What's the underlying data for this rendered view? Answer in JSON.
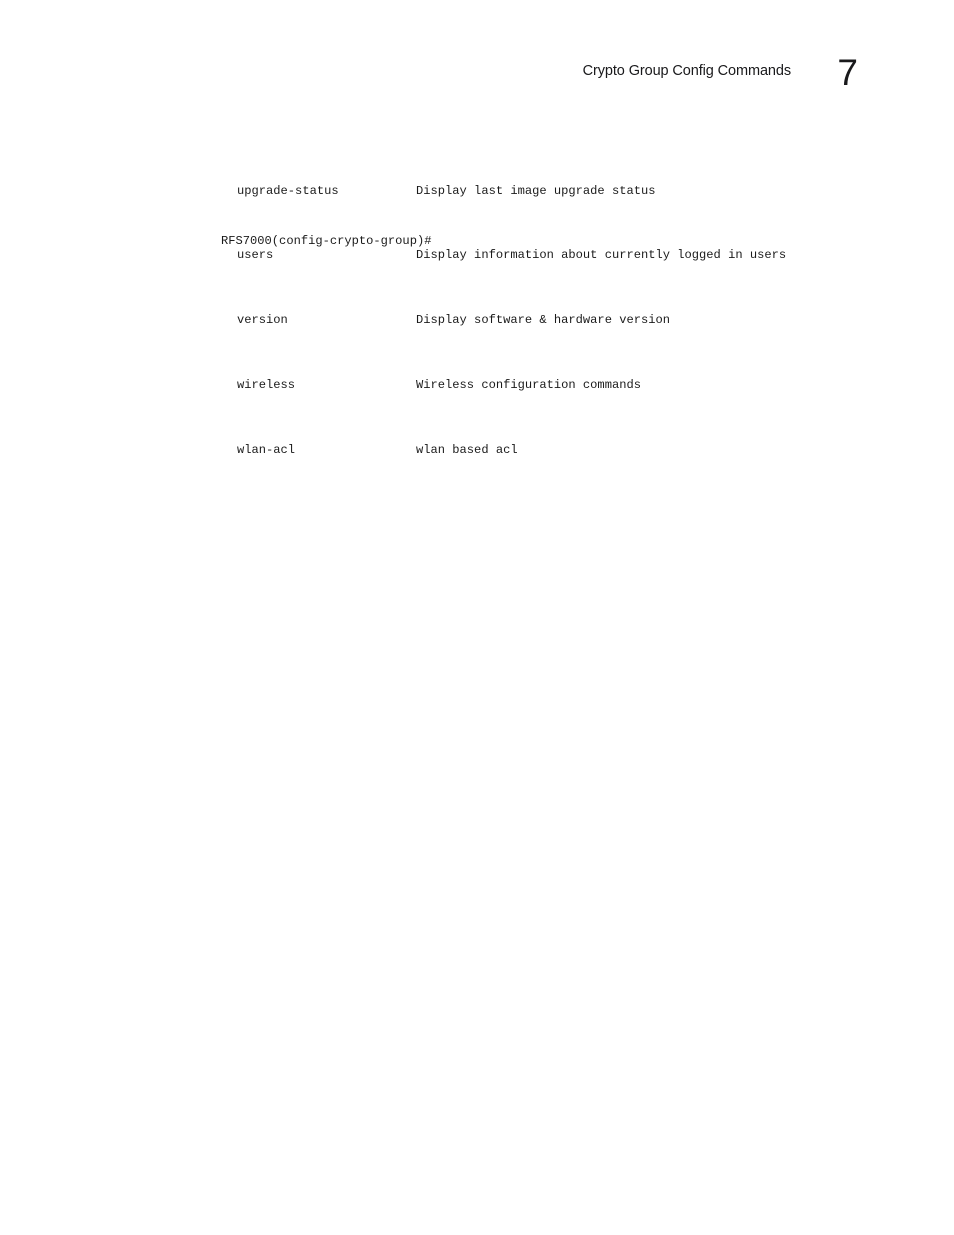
{
  "header": {
    "title": "Crypto Group Config Commands",
    "page_number": "7"
  },
  "console": {
    "rows": [
      {
        "command": "upgrade-status",
        "description": "Display last image upgrade status"
      },
      {
        "command": "users",
        "description": "Display information about currently logged in users"
      },
      {
        "command": "version",
        "description": "Display software & hardware version"
      },
      {
        "command": "wireless",
        "description": "Wireless configuration commands"
      },
      {
        "command": "wlan-acl",
        "description": "wlan based acl"
      }
    ],
    "prompt": "RFS7000(config-crypto-group)#"
  }
}
